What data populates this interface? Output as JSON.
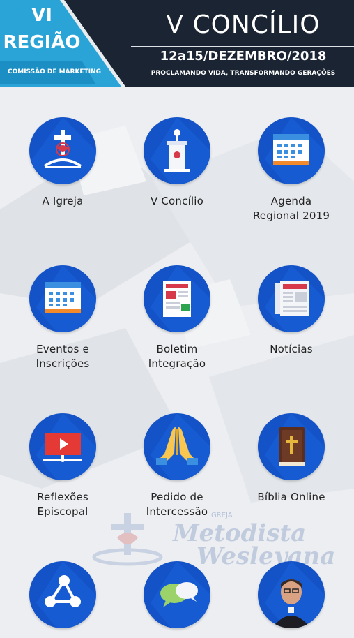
{
  "header": {
    "region_line1": "VI",
    "region_line2": "REGIÃO",
    "region_subtitle": "COMISSÃO DE MARKETING",
    "event_title": "V CONCÍLIO",
    "event_dates": "12a15/DEZEMBRO/2018",
    "event_tagline": "PROCLAMANDO VIDA, TRANSFORMANDO GERAÇÕES"
  },
  "watermark": {
    "word1": "IGREJA",
    "word2": "Metodista",
    "word3": "Wesleyana"
  },
  "colors": {
    "header_dark": "#1b2433",
    "header_cyan": "#2aa3d6",
    "icon_circle": "#1453c7",
    "label_text": "#222222"
  },
  "menu": [
    {
      "label": "A Igreja",
      "icon": "church-cross-icon"
    },
    {
      "label": "V Concílio",
      "icon": "pulpit-icon"
    },
    {
      "label": "Agenda\nRegional 2019",
      "icon": "calendar-icon"
    },
    {
      "label": "Eventos e\nInscrições",
      "icon": "calendar-icon"
    },
    {
      "label": "Boletim\nIntegração",
      "icon": "newsletter-icon"
    },
    {
      "label": "Notícias",
      "icon": "newspaper-icon"
    },
    {
      "label": "Reflexões\nEpiscopal",
      "icon": "video-player-icon"
    },
    {
      "label": "Pedido de\nIntercessão",
      "icon": "praying-hands-icon"
    },
    {
      "label": "Bíblia Online",
      "icon": "bible-icon"
    },
    {
      "label": "",
      "icon": "share-icon"
    },
    {
      "label": "",
      "icon": "chat-bubbles-icon"
    },
    {
      "label": "",
      "icon": "bishop-portrait-icon"
    }
  ]
}
